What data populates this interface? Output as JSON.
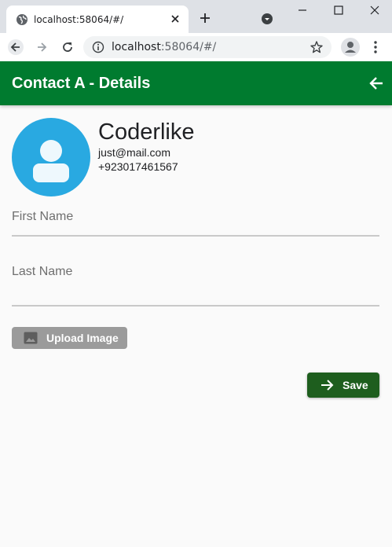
{
  "browser": {
    "tab_title": "localhost:58064/#/",
    "url_host": "localhost",
    "url_path": ":58064/#/"
  },
  "appbar": {
    "title": "Contact A - Details"
  },
  "contact": {
    "name": "Coderlike",
    "email": "just@mail.com",
    "phone": "+923017461567"
  },
  "form": {
    "first_name_label": "First Name",
    "first_name_value": "",
    "last_name_label": "Last Name",
    "last_name_value": ""
  },
  "buttons": {
    "upload_label": "Upload Image",
    "save_label": "Save"
  },
  "colors": {
    "appbar": "#007b2f",
    "avatar_bg": "#29a9e1",
    "save_button": "#1e5e1e",
    "upload_button": "#9b9b9b"
  }
}
